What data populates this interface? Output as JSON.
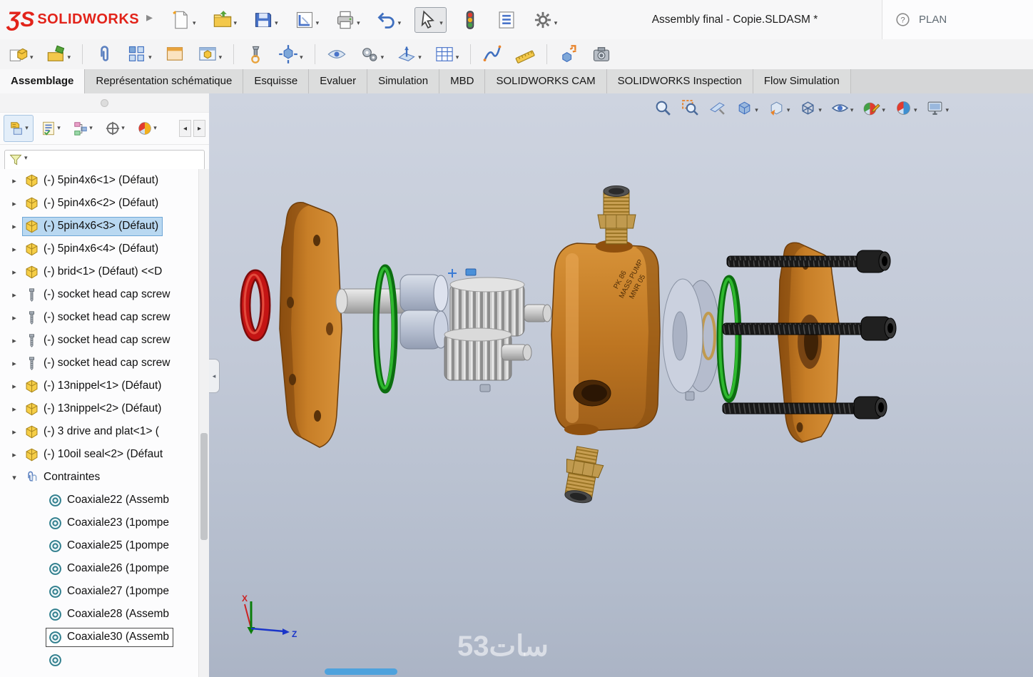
{
  "titlebar": {
    "logo_glyph": "ƷS",
    "brand": "SOLIDWORKS",
    "document_title": "Assembly final - Copie.SLDASM *",
    "help_glyph": "?",
    "search_value": "PLAN"
  },
  "main_toolbar": {
    "items": [
      {
        "name": "new-document",
        "icon": "new-document",
        "dropdown": true
      },
      {
        "name": "open",
        "icon": "open-folder",
        "dropdown": true
      },
      {
        "name": "save",
        "icon": "save",
        "dropdown": true
      },
      {
        "name": "make-drawing",
        "icon": "make-drawing",
        "dropdown": true
      },
      {
        "name": "print",
        "icon": "print",
        "dropdown": true
      },
      {
        "name": "undo",
        "icon": "undo",
        "dropdown": true
      },
      {
        "name": "select",
        "icon": "select-cursor",
        "dropdown": true,
        "pressed": true
      },
      {
        "name": "rebuild",
        "icon": "traffic-light",
        "dropdown": false
      },
      {
        "name": "task-pane",
        "icon": "task-list",
        "dropdown": false
      },
      {
        "name": "options",
        "icon": "gear",
        "dropdown": true
      }
    ]
  },
  "assembly_toolbar": {
    "items": [
      {
        "name": "insert-components",
        "icon": "insert-components",
        "dropdown": true
      },
      {
        "name": "open-part",
        "icon": "open-part",
        "dropdown": true
      },
      {
        "name": "mate",
        "icon": "mate-paperclip",
        "dropdown": false
      },
      {
        "name": "linear-component-pattern",
        "icon": "linear-pattern",
        "dropdown": true
      },
      {
        "name": "preview-window",
        "icon": "preview-window",
        "dropdown": false
      },
      {
        "name": "component-preview-window",
        "icon": "component-window",
        "dropdown": true
      },
      {
        "name": "smart-fasteners",
        "icon": "smart-fastener",
        "dropdown": false
      },
      {
        "name": "move-component",
        "icon": "move-component",
        "dropdown": true
      },
      {
        "name": "show-hidden-components",
        "icon": "show-hidden",
        "dropdown": false
      },
      {
        "name": "assembly-features",
        "icon": "assembly-features",
        "dropdown": true
      },
      {
        "name": "reference-geometry",
        "icon": "reference-geometry",
        "dropdown": true
      },
      {
        "name": "bill-of-materials",
        "icon": "bom-table",
        "dropdown": true
      },
      {
        "name": "motion-study",
        "icon": "spline",
        "dropdown": false
      },
      {
        "name": "measure",
        "icon": "measure",
        "dropdown": false
      },
      {
        "name": "exploded-view",
        "icon": "exploded-view",
        "dropdown": false
      },
      {
        "name": "snapshot",
        "icon": "camera",
        "dropdown": false
      }
    ]
  },
  "ribbon_tabs": {
    "active": "Assemblage",
    "items": [
      "Assemblage",
      "Représentation schématique",
      "Esquisse",
      "Evaluer",
      "Simulation",
      "MBD",
      "SOLIDWORKS CAM",
      "SOLIDWORKS Inspection",
      "Flow Simulation"
    ]
  },
  "panel_tabs": {
    "items": [
      {
        "name": "featuremanager",
        "icon": "featuremanager",
        "active": true
      },
      {
        "name": "propertymanager",
        "icon": "propertymanager",
        "active": false
      },
      {
        "name": "configurationmanager",
        "icon": "configmanager",
        "active": false
      },
      {
        "name": "dimxpertmanager",
        "icon": "dimxpert",
        "active": false
      },
      {
        "name": "displaymanager",
        "icon": "displaymanager",
        "active": false
      }
    ]
  },
  "feature_tree": {
    "items": [
      {
        "label": "(-) 5pin4x6<1> (Défaut)",
        "icon": "part",
        "arrow": "collapsed"
      },
      {
        "label": "(-) 5pin4x6<2> (Défaut)",
        "icon": "part",
        "arrow": "collapsed"
      },
      {
        "label": "(-) 5pin4x6<3> (Défaut)",
        "icon": "part",
        "arrow": "collapsed",
        "selected": true
      },
      {
        "label": "(-) 5pin4x6<4> (Défaut)",
        "icon": "part",
        "arrow": "collapsed"
      },
      {
        "label": "(-) brid<1> (Défaut) <<D",
        "icon": "part",
        "arrow": "collapsed"
      },
      {
        "label": "(-) socket head cap screw",
        "icon": "screw",
        "arrow": "collapsed"
      },
      {
        "label": "(-) socket head cap screw",
        "icon": "screw",
        "arrow": "collapsed"
      },
      {
        "label": "(-) socket head cap screw",
        "icon": "screw",
        "arrow": "collapsed"
      },
      {
        "label": "(-) socket head cap screw",
        "icon": "screw",
        "arrow": "collapsed"
      },
      {
        "label": "(-) 13nippel<1> (Défaut)",
        "icon": "part",
        "arrow": "collapsed"
      },
      {
        "label": "(-) 13nippel<2> (Défaut)",
        "icon": "part",
        "arrow": "collapsed"
      },
      {
        "label": "(-) 3 drive and plat<1> (",
        "icon": "part",
        "arrow": "collapsed"
      },
      {
        "label": "(-) 10oil seal<2> (Défaut",
        "icon": "part",
        "arrow": "collapsed"
      },
      {
        "label": "Contraintes",
        "icon": "mates",
        "arrow": "expanded"
      },
      {
        "label": "Coaxiale22 (Assemb",
        "icon": "coaxial",
        "indent": 1
      },
      {
        "label": "Coaxiale23 (1pompe",
        "icon": "coaxial",
        "indent": 1
      },
      {
        "label": "Coaxiale25 (1pompe",
        "icon": "coaxial",
        "indent": 1
      },
      {
        "label": "Coaxiale26 (1pompe",
        "icon": "coaxial",
        "indent": 1
      },
      {
        "label": "Coaxiale27 (1pompe",
        "icon": "coaxial",
        "indent": 1
      },
      {
        "label": "Coaxiale28 (Assemb",
        "icon": "coaxial",
        "indent": 1
      },
      {
        "label": "Coaxiale30 (Assemb",
        "icon": "coaxial",
        "indent": 1,
        "focused": true
      },
      {
        "label": "",
        "icon": "coaxial",
        "indent": 1
      }
    ]
  },
  "heads_up": {
    "items": [
      {
        "name": "zoom-to-fit",
        "icon": "magnifier",
        "dropdown": false
      },
      {
        "name": "zoom-to-area",
        "icon": "magnifier-area",
        "dropdown": false
      },
      {
        "name": "section-view",
        "icon": "section-knife",
        "dropdown": false
      },
      {
        "name": "view-orientation",
        "icon": "view-cube",
        "dropdown": true
      },
      {
        "name": "previous-view",
        "icon": "prev-view",
        "dropdown": true
      },
      {
        "name": "display-style",
        "icon": "wire-cube",
        "dropdown": true
      },
      {
        "name": "hide-show-items",
        "icon": "eye",
        "dropdown": true
      },
      {
        "name": "edit-appearance",
        "icon": "ball-pencil",
        "dropdown": true
      },
      {
        "name": "apply-scene",
        "icon": "ball",
        "dropdown": true
      },
      {
        "name": "view-settings",
        "icon": "monitor",
        "dropdown": true
      }
    ]
  },
  "viewport": {
    "marking_line1": "PK 86",
    "marking_line2": "MASS PUMP",
    "marking_line3": "MNR 05",
    "triad": {
      "x_label": "X",
      "z_label": "Z"
    },
    "watermark": "سات53"
  }
}
